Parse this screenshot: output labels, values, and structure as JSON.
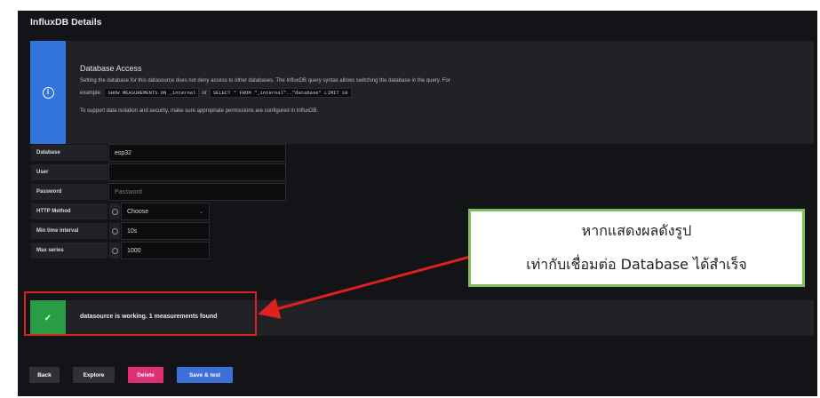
{
  "section_title": "InfluxDB Details",
  "info": {
    "title": "Database Access",
    "line1": "Setting the database for this datasource does not deny access to other databases. The InfluxDB query syntax allows switching the database in the query. For",
    "line2_prefix": "example:",
    "code1": "SHOW MEASUREMENTS ON _internal",
    "or": "or",
    "code2": "SELECT * FROM \"_internal\"..\"database\" LIMIT 10",
    "line3": "To support data isolation and security, make sure appropriate permissions are configured in InfluxDB."
  },
  "form": {
    "database": {
      "label": "Database",
      "value": "esp32"
    },
    "user": {
      "label": "User",
      "value": ""
    },
    "password": {
      "label": "Password",
      "placeholder": "Password"
    },
    "http_method": {
      "label": "HTTP Method",
      "value": "Choose"
    },
    "min_time_interval": {
      "label": "Min time interval",
      "value": "10s"
    },
    "max_series": {
      "label": "Max series",
      "value": "1000"
    }
  },
  "status": {
    "text": "datasource is working. 1 measurements found"
  },
  "buttons": {
    "back": "Back",
    "explore": "Explore",
    "delete": "Delete",
    "save": "Save & test"
  },
  "callout": {
    "line1": "หากแสดงผลดังรูป",
    "line2": "เท่ากับเชื่อมต่อ Database ได้สำเร็จ"
  },
  "colors": {
    "info_accent": "#3274d9",
    "success": "#299c46",
    "delete": "#e02f75",
    "primary": "#3d71d9",
    "highlight": "#e01f1f",
    "callout_border": "#7fbf5a"
  }
}
